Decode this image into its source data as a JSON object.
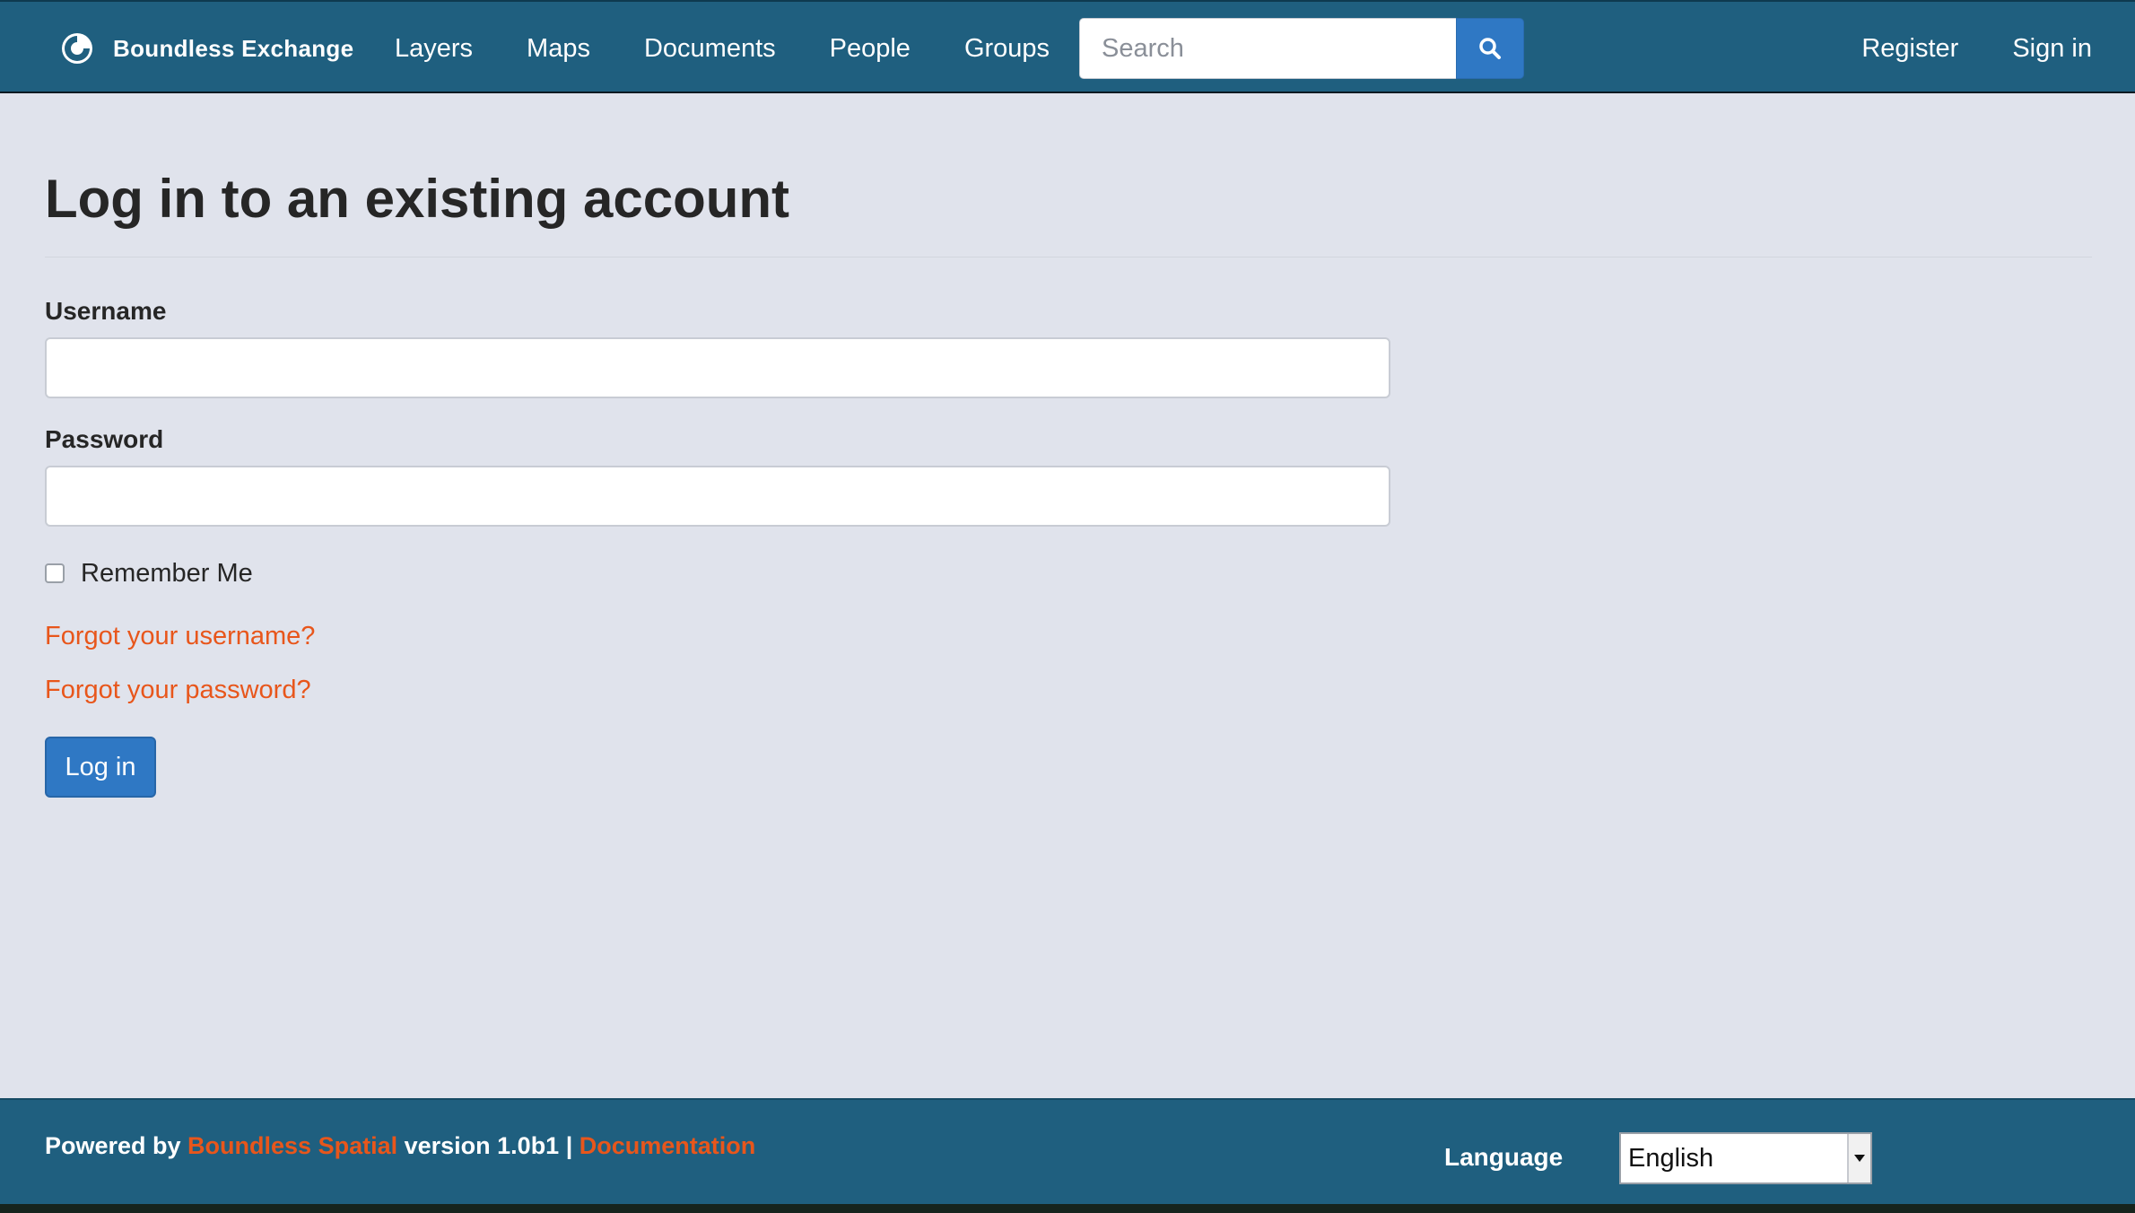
{
  "navbar": {
    "brand": "Boundless Exchange",
    "links": [
      "Layers",
      "Maps",
      "Documents",
      "People",
      "Groups"
    ],
    "search_placeholder": "Search",
    "right_links": [
      "Register",
      "Sign in"
    ]
  },
  "main": {
    "title": "Log in to an existing account",
    "username_label": "Username",
    "username_value": "",
    "password_label": "Password",
    "password_value": "",
    "remember_label": "Remember Me",
    "remember_checked": false,
    "forgot_username": "Forgot your username?",
    "forgot_password": "Forgot your password?",
    "login_button": "Log in"
  },
  "footer": {
    "powered_by": "Powered by ",
    "company_link": "Boundless Spatial",
    "version_text": " version 1.0b1 | ",
    "docs_link": "Documentation",
    "language_label": "Language",
    "language_selected": "English"
  },
  "colors": {
    "navbar": "#1f5f7f",
    "page_background": "#e0e3ec",
    "primary_button": "#2f78c4",
    "link": "#e8561b"
  },
  "icons": {
    "brand": "boundless-logo-icon",
    "search": "search-icon",
    "select_arrow": "caret-down-icon"
  }
}
